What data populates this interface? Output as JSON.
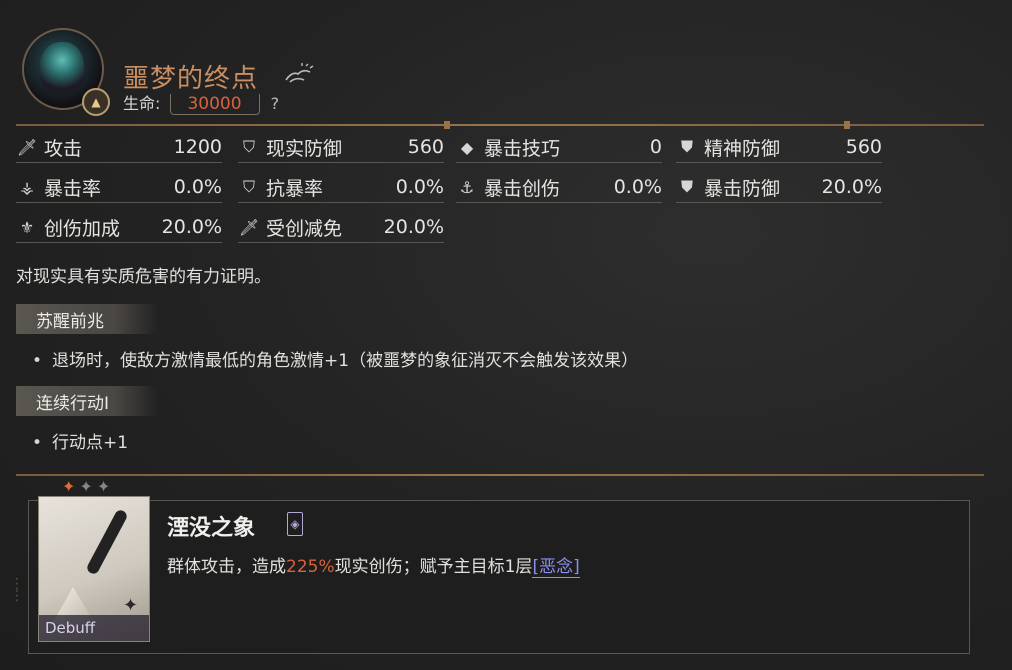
{
  "enemy": {
    "name": "噩梦的终点",
    "hp_label": "生命:",
    "hp_value": "30000",
    "hp_help": "?",
    "badge_icon": "triangle-rank-icon",
    "title_icon": "hand-wave-icon"
  },
  "stats": [
    {
      "icon": "sword-icon",
      "label": "攻击",
      "value": "1200"
    },
    {
      "icon": "shield-icon",
      "label": "现实防御",
      "value": "560"
    },
    {
      "icon": "diamond-icon",
      "label": "暴击技巧",
      "value": "0"
    },
    {
      "icon": "mind-shield-icon",
      "label": "精神防御",
      "value": "560"
    },
    {
      "icon": "crit-rate-icon",
      "label": "暴击率",
      "value": "0.0%"
    },
    {
      "icon": "crit-resist-icon",
      "label": "抗暴率",
      "value": "0.0%"
    },
    {
      "icon": "crit-damage-icon",
      "label": "暴击创伤",
      "value": "0.0%"
    },
    {
      "icon": "crit-defense-icon",
      "label": "暴击防御",
      "value": "20.0%"
    },
    {
      "icon": "damage-bonus-icon",
      "label": "创伤加成",
      "value": "20.0%"
    },
    {
      "icon": "damage-reduction-icon",
      "label": "受创减免",
      "value": "20.0%"
    }
  ],
  "description": "对现实具有实质危害的有力证明。",
  "sections": [
    {
      "title": "苏醒前兆",
      "bullets": [
        "退场时，使敌方激情最低的角色激情+1（被噩梦的象征消灭不会触发该效果）"
      ]
    },
    {
      "title": "连续行动I",
      "bullets": [
        "行动点+1"
      ]
    }
  ],
  "skill": {
    "name": "湮没之象",
    "tag": "Debuff",
    "desc_prefix": "群体攻击，造成",
    "desc_pct": "225%",
    "desc_mid": "现实创伤；赋予主目标1层",
    "desc_keyword": "[恶念]",
    "stars": [
      "✦",
      "✦",
      "✦"
    ]
  },
  "colors": {
    "accent_orange": "#d9623b",
    "title_copper": "#c98f62",
    "keyword_blue": "#8a8ff0"
  }
}
